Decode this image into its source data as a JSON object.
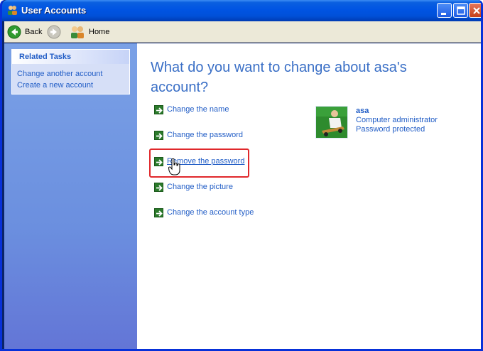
{
  "window": {
    "title": "User Accounts",
    "controls": {
      "minimize": "minimize",
      "maximize": "maximize",
      "close": "close"
    }
  },
  "toolbar": {
    "back_label": "Back",
    "home_label": "Home"
  },
  "sidebar": {
    "task_header": "Related Tasks",
    "tasks": [
      {
        "label": "Change another account"
      },
      {
        "label": "Create a new account"
      }
    ]
  },
  "main": {
    "heading": "What do you want to change about asa's account?",
    "actions": [
      {
        "label": "Change the name"
      },
      {
        "label": "Change the password"
      },
      {
        "label": "Remove the password",
        "hovered": true
      },
      {
        "label": "Change the picture"
      },
      {
        "label": "Change the account type"
      }
    ]
  },
  "account": {
    "name": "asa",
    "type": "Computer administrator",
    "status": "Password protected"
  },
  "colors": {
    "title_bar": "#0054e3",
    "sidebar": "#6b8fdf",
    "link": "#215dc6",
    "heading": "#3a6fc6",
    "highlight": "#e0282b"
  }
}
